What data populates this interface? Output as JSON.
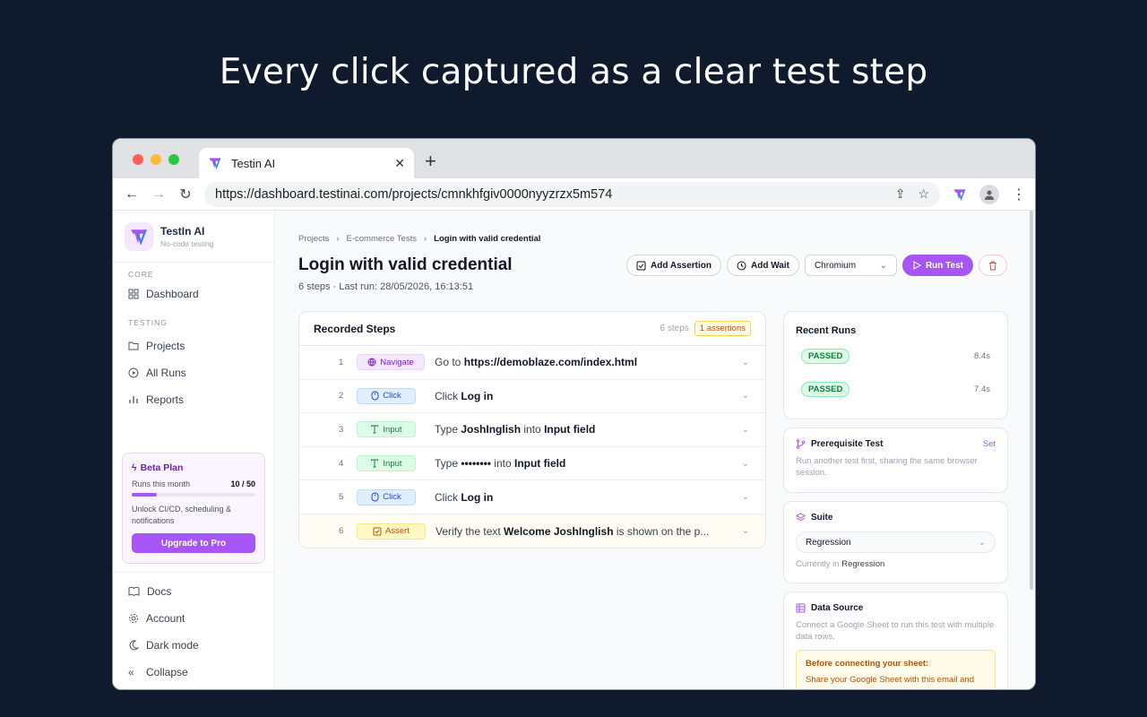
{
  "headline": "Every click captured as a clear test step",
  "browser": {
    "tab_title": "Testin AI",
    "url": "https://dashboard.testinai.com/projects/cmnkhfgiv0000nyyzrzx5m574"
  },
  "sidebar": {
    "brand_name": "TestIn AI",
    "brand_sub": "No-code testing",
    "section_core": "CORE",
    "section_testing": "TESTING",
    "items": [
      {
        "label": "Dashboard"
      },
      {
        "label": "Projects"
      },
      {
        "label": "All Runs"
      },
      {
        "label": "Reports"
      }
    ],
    "plan": {
      "title": "Beta Plan",
      "runs_label": "Runs this month",
      "runs_value": "10 / 50",
      "runs_fraction": 0.2,
      "desc": "Unlock CI/CD, scheduling & notifications",
      "button": "Upgrade to Pro"
    },
    "bottom": [
      {
        "label": "Docs"
      },
      {
        "label": "Account"
      },
      {
        "label": "Dark mode"
      },
      {
        "label": "Collapse"
      }
    ]
  },
  "page": {
    "breadcrumbs": [
      "Projects",
      "E-commerce Tests",
      "Login with valid credential"
    ],
    "title": "Login with valid credential",
    "subtitle": "6 steps · Last run: 28/05/2026, 16:13:51",
    "actions": {
      "add_assertion": "Add Assertion",
      "add_wait": "Add Wait",
      "browser": "Chromium",
      "run": "Run Test"
    }
  },
  "steps": {
    "title": "Recorded Steps",
    "count": "6 steps",
    "assertions": "1 assertions",
    "items": [
      {
        "num": "1",
        "tag": "Navigate",
        "pre": "Go to ",
        "b1": "https://demoblaze.com/index.html",
        "mid": "",
        "b2": "",
        "post": ""
      },
      {
        "num": "2",
        "tag": "Click",
        "pre": "Click ",
        "b1": "Log in",
        "mid": "",
        "b2": "",
        "post": ""
      },
      {
        "num": "3",
        "tag": "Input",
        "pre": "Type ",
        "b1": "JoshInglish",
        "mid": " into ",
        "b2": "Input field",
        "post": ""
      },
      {
        "num": "4",
        "tag": "Input",
        "pre": "Type ",
        "b1": "••••••••",
        "mid": " into ",
        "b2": "Input field",
        "post": ""
      },
      {
        "num": "5",
        "tag": "Click",
        "pre": "Click ",
        "b1": "Log in",
        "mid": "",
        "b2": "",
        "post": ""
      },
      {
        "num": "6",
        "tag": "Assert",
        "pre": "Verify the text ",
        "b1": "Welcome JoshInglish",
        "mid": " is shown on the p...",
        "b2": "",
        "post": ""
      }
    ]
  },
  "recent_runs": {
    "title": "Recent Runs",
    "runs": [
      {
        "status": "PASSED",
        "duration": "8.4s"
      },
      {
        "status": "PASSED",
        "duration": "7.4s"
      }
    ]
  },
  "prerequisite": {
    "title": "Prerequisite Test",
    "link": "Set",
    "desc": "Run another test first, sharing the same browser session."
  },
  "suite": {
    "title": "Suite",
    "value": "Regression",
    "current_prefix": "Currently in ",
    "current": "Regression"
  },
  "data_source": {
    "title": "Data Source",
    "desc": "Connect a Google Sheet to run this test with multiple data rows.",
    "warn_title": "Before connecting your sheet:",
    "warn_desc": "Share your Google Sheet with this email and"
  },
  "colors": {
    "accent": "#a855f7",
    "background": "#0f1b2d"
  }
}
